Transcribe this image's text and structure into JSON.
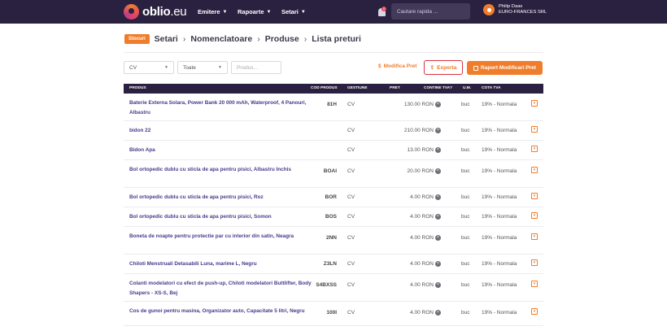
{
  "app": {
    "logo_text": "oblio",
    "logo_suffix": ".eu"
  },
  "nav": {
    "items": [
      {
        "label": "Emitere"
      },
      {
        "label": "Rapoarte"
      },
      {
        "label": "Setari"
      }
    ],
    "notification_count": "0",
    "search_placeholder": "Cautare rapida ..."
  },
  "user": {
    "name": "Philip Daas",
    "company": "EURO-FRANCES SRL"
  },
  "breadcrumb": {
    "tag": "Stocuri",
    "items": [
      "Setari",
      "Nomenclatoare",
      "Produse",
      "Lista preturi"
    ]
  },
  "filters": {
    "gestiune": "CV",
    "tip": "Toate",
    "product_placeholder": "Produs..."
  },
  "actions": {
    "modify_price": "Modifica Pret",
    "export": "Exporta",
    "report": "Raport Modificari Pret"
  },
  "table": {
    "headers": {
      "product": "PRODUS",
      "code": "COD PRODUS",
      "gestiune": "GESTIUNE",
      "price": "PRET",
      "contains_vat": "CONTINE TVA?",
      "um": "U.M.",
      "vat_rate": "COTA TVA"
    },
    "rows": [
      {
        "name": "Baterie Externa Solara, Power Bank 20 000 mAh, Waterproof, 4 Panouri, Albastru",
        "code": "81H",
        "gestiune": "CV",
        "price": "130.00 RON",
        "um": "buc",
        "vat": "19% - Normala"
      },
      {
        "name": "bidon 22",
        "code": "",
        "gestiune": "CV",
        "price": "210.00 RON",
        "um": "buc",
        "vat": "19% - Normala"
      },
      {
        "name": "Bidon Apa",
        "code": "",
        "gestiune": "CV",
        "price": "13.00 RON",
        "um": "buc",
        "vat": "19% - Normala"
      },
      {
        "name": "Bol ortopedic dublu cu sticla de apa pentru pisici, Albastru Inchis",
        "code": "BOAI",
        "gestiune": "CV",
        "price": "20.00 RON",
        "um": "buc",
        "vat": "19% - Normala"
      },
      {
        "name": "Bol ortopedic dublu cu sticla de apa pentru pisici, Roz",
        "code": "BOR",
        "gestiune": "CV",
        "price": "4.00 RON",
        "um": "buc",
        "vat": "19% - Normala"
      },
      {
        "name": "Bol ortopedic dublu cu sticla de apa pentru pisici, Somon",
        "code": "BOS",
        "gestiune": "CV",
        "price": "4.00 RON",
        "um": "buc",
        "vat": "19% - Normala"
      },
      {
        "name": "Boneta de noapte pentru protectie par cu interior din satin, Neagra",
        "code": "2NN",
        "gestiune": "CV",
        "price": "4.00 RON",
        "um": "buc",
        "vat": "19% - Normala"
      },
      {
        "name": "Chiloti Menstruali Detasabili Luna, marime L, Negru",
        "code": "Z3LN",
        "gestiune": "CV",
        "price": "4.00 RON",
        "um": "buc",
        "vat": "19% - Normala"
      },
      {
        "name": "Colanti modelatori cu efect de push-up, Chiloti modelatori Buttlifter, Body Shapers - XS-S, Bej",
        "code": "S4BXSS",
        "gestiune": "CV",
        "price": "4.00 RON",
        "um": "buc",
        "vat": "19% - Normala"
      },
      {
        "name": "Cos de gunoi pentru masina, Organizator auto, Capacitate 5 litri, Negru",
        "code": "100I",
        "gestiune": "CV",
        "price": "4.00 RON",
        "um": "buc",
        "vat": "19% - Normala"
      }
    ]
  }
}
